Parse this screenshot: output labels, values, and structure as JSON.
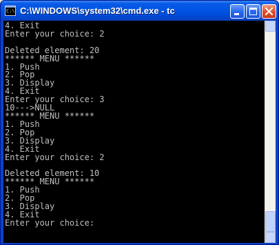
{
  "window": {
    "title": "C:\\WINDOWS\\system32\\cmd.exe - tc",
    "icon_label": "C:\\"
  },
  "console": {
    "lines": [
      "4. Exit",
      "Enter your choice: 2",
      "",
      "Deleted element: 20",
      "****** MENU ******",
      "1. Push",
      "2. Pop",
      "3. Display",
      "4. Exit",
      "Enter your choice: 3",
      "10--->NULL",
      "****** MENU ******",
      "1. Push",
      "2. Pop",
      "3. Display",
      "4. Exit",
      "Enter your choice: 2",
      "",
      "Deleted element: 10",
      "****** MENU ******",
      "1. Push",
      "2. Pop",
      "3. Display",
      "4. Exit",
      "Enter your choice:"
    ]
  },
  "colors": {
    "titlebar": "#0055e5",
    "console_background": "#000000",
    "console_text": "#c0c0c0",
    "close_button": "#e0502d"
  },
  "icons": {
    "app": "console-icon",
    "minimize": "minimize-icon",
    "maximize": "maximize-icon",
    "close": "close-icon"
  }
}
